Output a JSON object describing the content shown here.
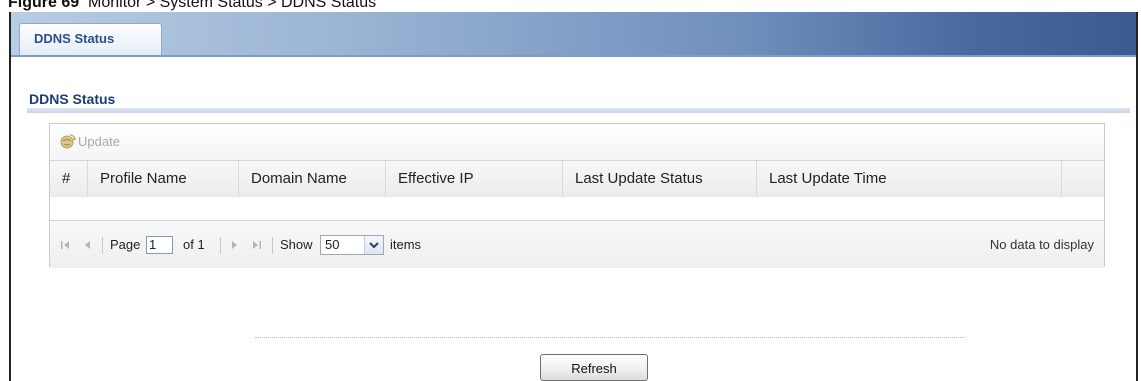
{
  "figure": {
    "label": "Figure 69",
    "caption": "Monitor > System Status > DDNS Status"
  },
  "tabs": [
    {
      "label": "DDNS Status",
      "active": true
    }
  ],
  "section": {
    "title": "DDNS Status"
  },
  "toolbar": {
    "update_label": "Update",
    "update_enabled": false,
    "update_icon": "update-globe-icon"
  },
  "table": {
    "columns": [
      "#",
      "Profile Name",
      "Domain Name",
      "Effective IP",
      "Last Update Status",
      "Last Update Time"
    ],
    "rows": []
  },
  "pager": {
    "page_label": "Page",
    "page_value": "1",
    "of_label": "of 1",
    "show_label": "Show",
    "show_value": "50",
    "items_label": "items",
    "empty_message": "No data to display"
  },
  "actions": {
    "refresh_label": "Refresh"
  },
  "colors": {
    "tab_text": "#2a4f8a",
    "section_title": "#1c3d73",
    "disabled_text": "#a8a8a8"
  }
}
